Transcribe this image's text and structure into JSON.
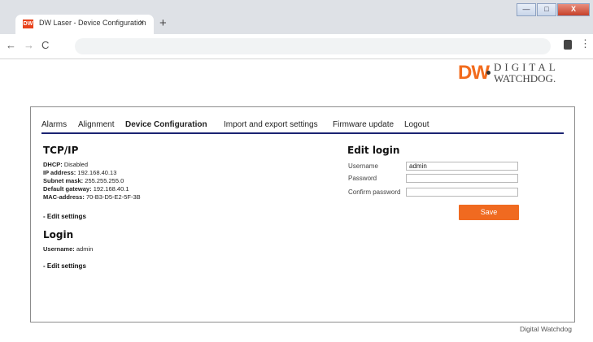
{
  "browser": {
    "tab_favicon": "DW",
    "tab_title": "DW Laser - Device Configuration",
    "tab_close": "×",
    "new_tab": "+",
    "back": "←",
    "forward": "→",
    "reload": "C",
    "menu": "⋮",
    "window_controls": {
      "minimize": "—",
      "maximize": "□",
      "close": "X"
    }
  },
  "logo": {
    "mark": "DW",
    "line1": "DIGITAL",
    "line2": "WATCHDOG."
  },
  "nav": {
    "items": [
      {
        "label": "Alarms"
      },
      {
        "label": "Alignment"
      },
      {
        "label": "Device Configuration",
        "active": true
      },
      {
        "label": "Import and export settings"
      },
      {
        "label": "Firmware update"
      },
      {
        "label": "Logout"
      }
    ]
  },
  "tcpip": {
    "title": "TCP/IP",
    "dhcp_label": "DHCP:",
    "dhcp_value": "Disabled",
    "ip_label": "IP address:",
    "ip_value": "192.168.40.13",
    "mask_label": "Subnet mask:",
    "mask_value": "255.255.255.0",
    "gateway_label": "Default gateway:",
    "gateway_value": "192.168.40.1",
    "mac_label": "MAC-address:",
    "mac_value": "70-B3-D5-E2-5F-3B",
    "edit_link": "- Edit settings"
  },
  "login": {
    "title": "Login",
    "username_label": "Username:",
    "username_value": "admin",
    "edit_link": "- Edit settings"
  },
  "edit_login": {
    "title": "Edit login",
    "username_label": "Username",
    "username_value": "admin",
    "password_label": "Password",
    "password_value": "",
    "confirm_label": "Confirm password",
    "confirm_value": "",
    "save_label": "Save"
  },
  "footer": {
    "text": "Digital Watchdog"
  },
  "colors": {
    "accent": "#f06a20",
    "nav_rule": "#1b2372"
  }
}
